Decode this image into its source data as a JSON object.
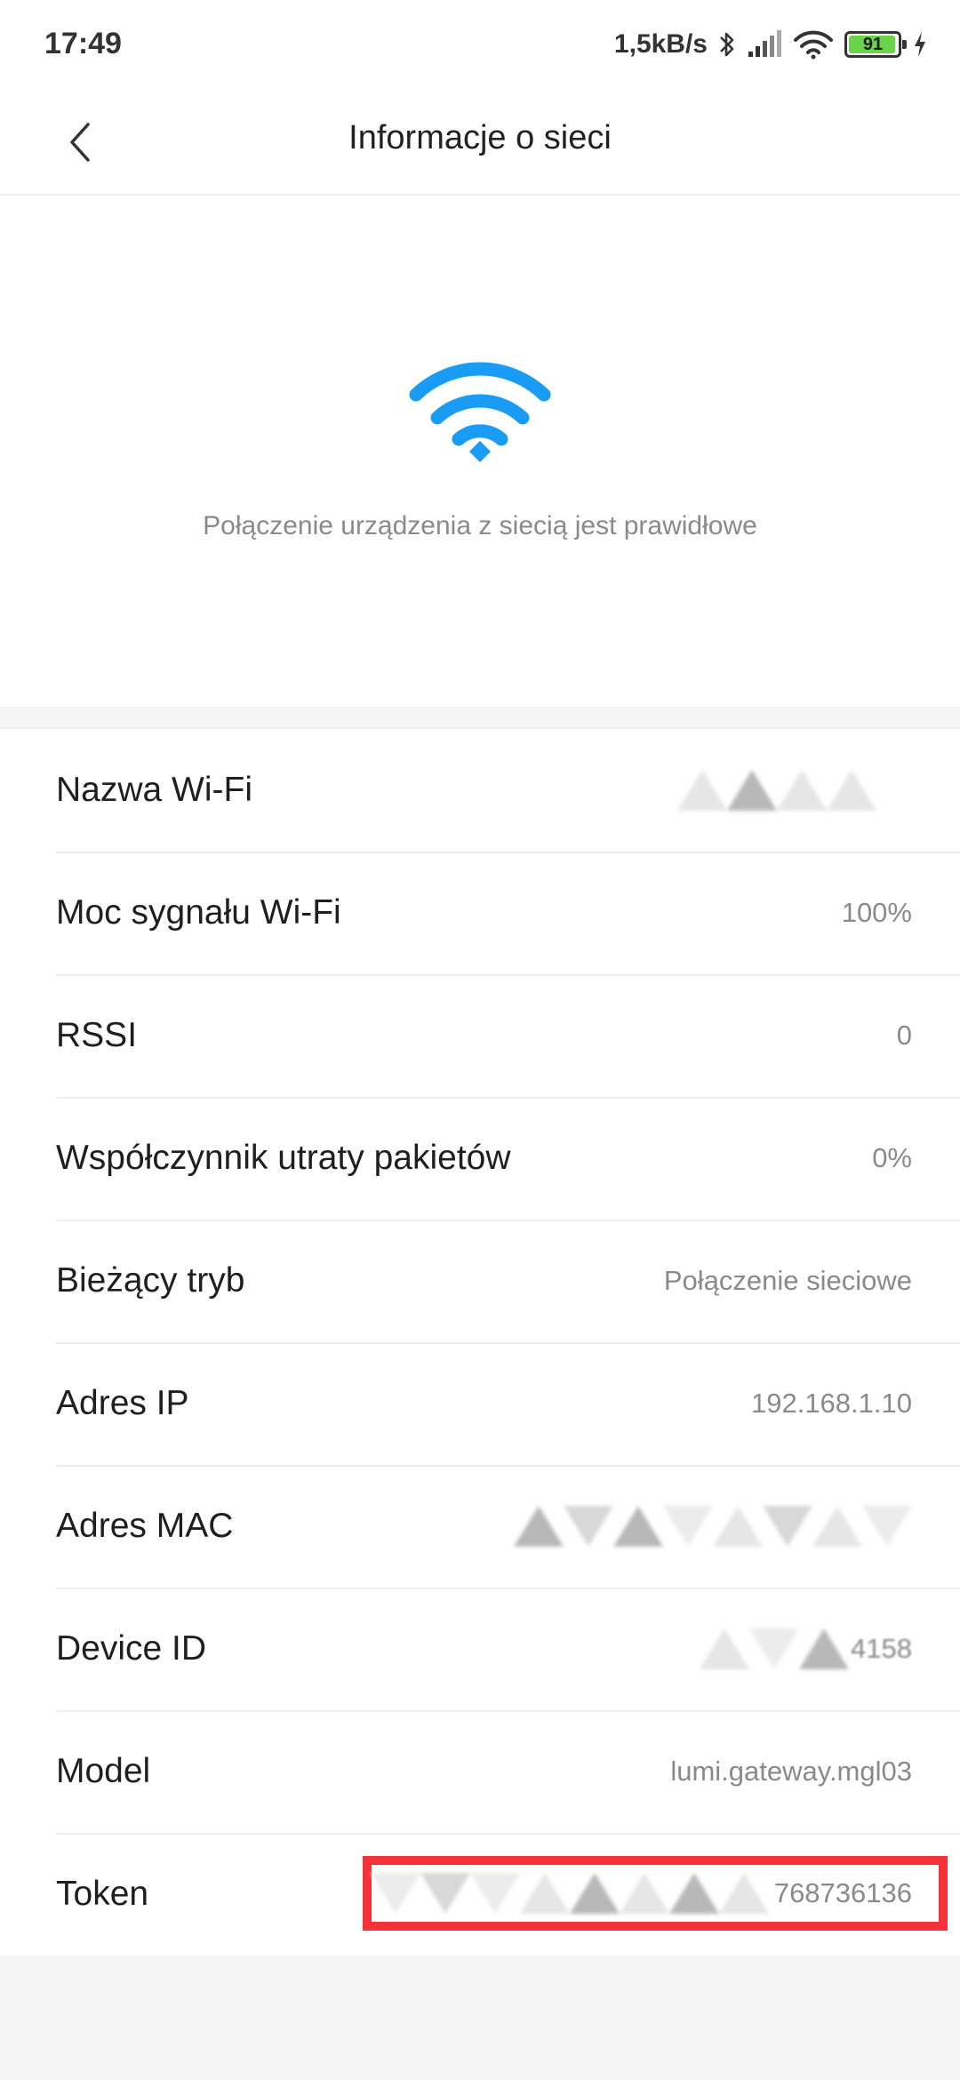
{
  "status_bar": {
    "time": "17:49",
    "net_speed": "1,5kB/s",
    "battery_level": "91",
    "icons": [
      "bluetooth-icon",
      "signal-icon",
      "wifi-icon",
      "battery-icon",
      "charging-icon"
    ]
  },
  "header": {
    "title": "Informacje o sieci",
    "back_icon": "chevron-left-icon"
  },
  "hero": {
    "icon": "wifi-icon",
    "icon_color": "#1a9cf5",
    "status_text": "Połączenie urządzenia z siecią jest prawidłowe"
  },
  "rows": [
    {
      "label": "Nazwa Wi-Fi",
      "value": ""
    },
    {
      "label": "Moc sygnału Wi-Fi",
      "value": "100%"
    },
    {
      "label": "RSSI",
      "value": "0"
    },
    {
      "label": "Współczynnik utraty pakietów",
      "value": "0%"
    },
    {
      "label": "Bieżący tryb",
      "value": "Połączenie sieciowe"
    },
    {
      "label": "Adres IP",
      "value": "192.168.1.10"
    },
    {
      "label": "Adres MAC",
      "value": ""
    },
    {
      "label": "Device ID",
      "value": "4158"
    },
    {
      "label": "Model",
      "value": "lumi.gateway.mgl03"
    },
    {
      "label": "Token",
      "value": "768736136"
    }
  ],
  "colors": {
    "highlight_border": "#f5323a",
    "battery_fill": "#6bd349"
  }
}
